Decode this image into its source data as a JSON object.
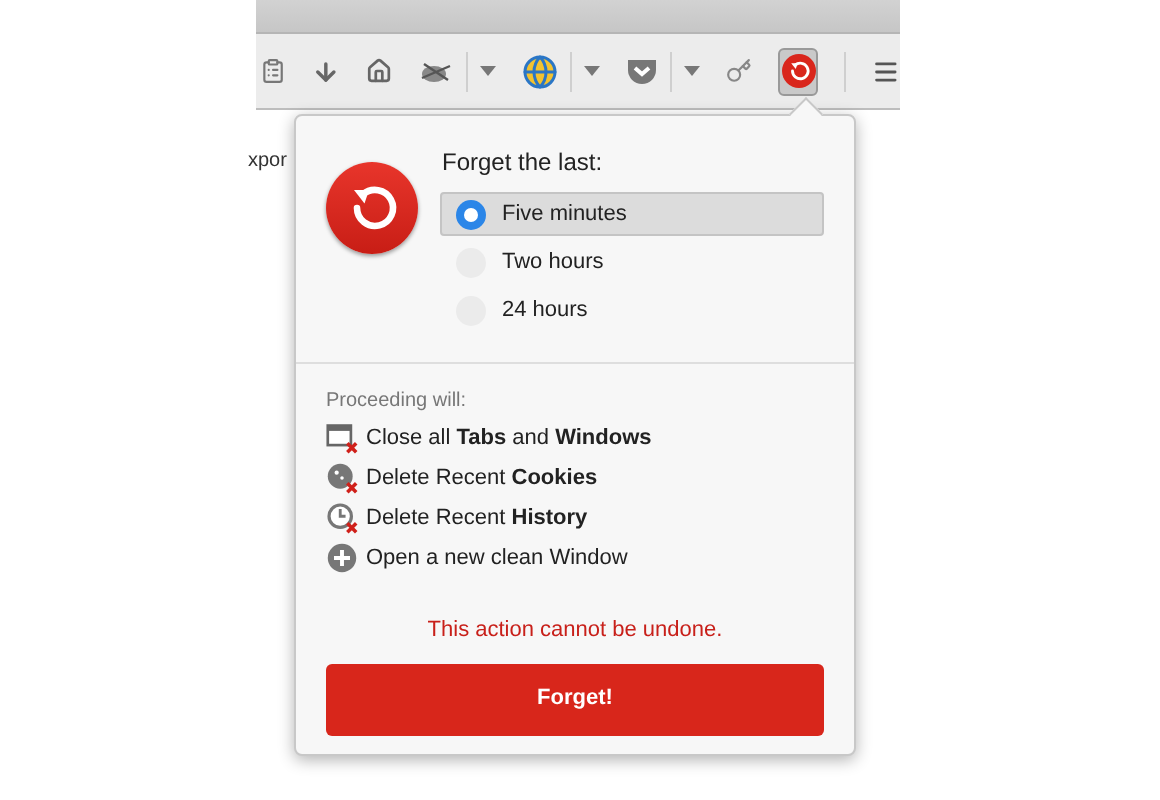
{
  "toolbar": {
    "forget_button": {
      "pressed": true
    }
  },
  "page": {
    "text": "xpor"
  },
  "popup": {
    "heading": "Forget the last:",
    "options": [
      {
        "label": "Five minutes",
        "selected": true
      },
      {
        "label": "Two hours",
        "selected": false
      },
      {
        "label": "24 hours",
        "selected": false
      }
    ],
    "section_label": "Proceeding will:",
    "actions": [
      {
        "kind": "window",
        "text": "Close all **Tabs** and **Windows**"
      },
      {
        "kind": "cookie",
        "text": "Delete Recent **Cookies**"
      },
      {
        "kind": "history",
        "text": "Delete Recent **History**"
      },
      {
        "kind": "plus",
        "text": "Open a new clean Window"
      }
    ],
    "warning": "This action cannot be undone.",
    "button": "Forget!"
  }
}
